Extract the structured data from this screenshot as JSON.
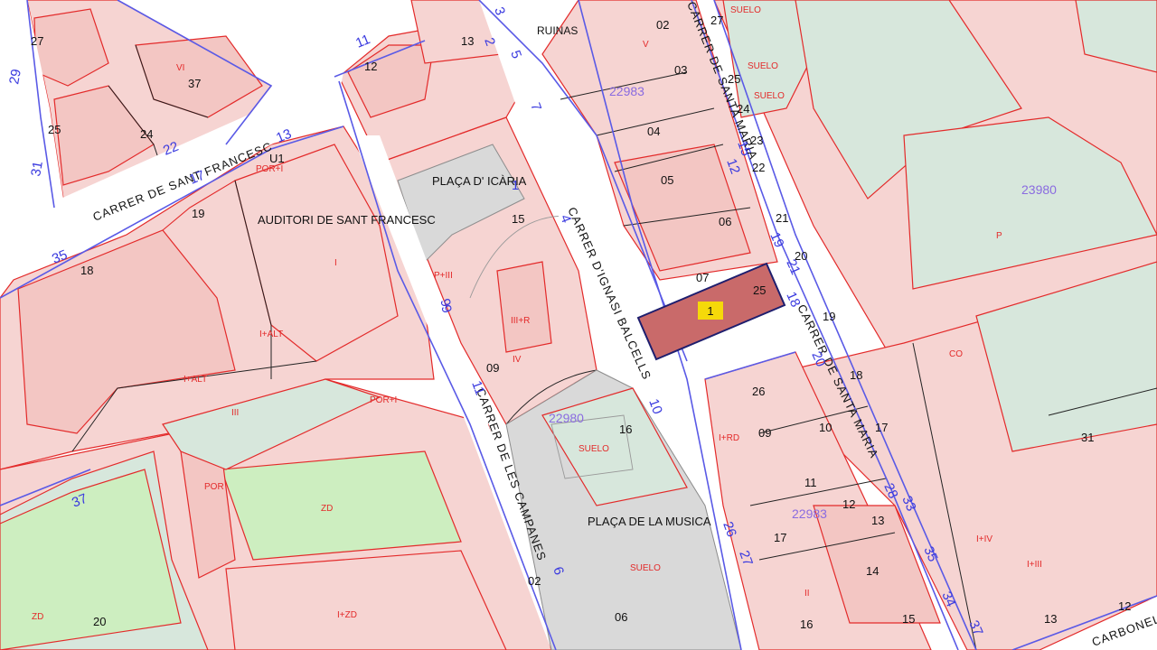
{
  "map": {
    "streets": [
      {
        "id": "sant-francesc",
        "label": "CARRER DE SANT FRANCESC"
      },
      {
        "id": "ignasi-balcells",
        "label": "CARRER D'IGNASI BALCELLS"
      },
      {
        "id": "campanes",
        "label": "CARRER DE LES CAMPANES"
      },
      {
        "id": "santa-maria-lower",
        "label": "CARRER DE SANTA MARIA"
      },
      {
        "id": "santa-maria-upper",
        "label": "CARRER DE SANTA MARIA"
      },
      {
        "id": "carbonell",
        "label": "CARBONEL"
      }
    ],
    "places": [
      {
        "id": "placa-icaria",
        "label": "PLAÇA D' ICÀRIA"
      },
      {
        "id": "auditori",
        "label": "AUDITORI DE SANT FRANCESC"
      },
      {
        "id": "placa-musica",
        "label": "PLAÇA DE LA MUSICA"
      }
    ],
    "block_codes": [
      "22983",
      "23980",
      "22980",
      "22983"
    ],
    "marker": {
      "label": "1",
      "fill": "#c96a6a",
      "badge": "#f5d90a"
    },
    "parcel_numbers": [
      "27",
      "13",
      "12",
      "37",
      "25",
      "24",
      "U1",
      "19",
      "18",
      "15",
      "09",
      "02",
      "20",
      "16",
      "06",
      "05",
      "04",
      "03",
      "02",
      "27",
      "25",
      "24",
      "23",
      "22",
      "21",
      "20",
      "19",
      "18",
      "17",
      "31",
      "26",
      "10",
      "09",
      "11",
      "12",
      "13",
      "14",
      "15",
      "16",
      "13",
      "12",
      "07",
      "25",
      "17",
      "06"
    ],
    "zoning_labels": [
      "RUINAS",
      "SUELO",
      "SUELO",
      "SUELO",
      "SUELO",
      "SUELO",
      "ZD",
      "ZD",
      "I+ZD",
      "I+ALT",
      "I+ALT",
      "POR+I",
      "POR+I",
      "POR",
      "I",
      "III",
      "IV",
      "V",
      "VI",
      "II",
      "P",
      "CO",
      "I+IV",
      "I+III",
      "I+RD",
      "III+R",
      "P+III"
    ],
    "blue_numbers": [
      "29",
      "31",
      "35",
      "37",
      "22",
      "17",
      "13",
      "11",
      "3",
      "5",
      "9",
      "7",
      "1",
      "4",
      "9",
      "10",
      "11",
      "6",
      "2",
      "12",
      "15",
      "27",
      "26",
      "28",
      "33",
      "34",
      "35",
      "37",
      "20",
      "19",
      "21",
      "18"
    ],
    "colors": {
      "parcel": "#f6d4d2",
      "parcel_dark": "#f3c6c3",
      "green_parcel": "#d7e7dc",
      "green_zone": "#cdeec0",
      "boundary_red": "#e32a2a",
      "boundary_blue": "#5a5ae6"
    }
  }
}
